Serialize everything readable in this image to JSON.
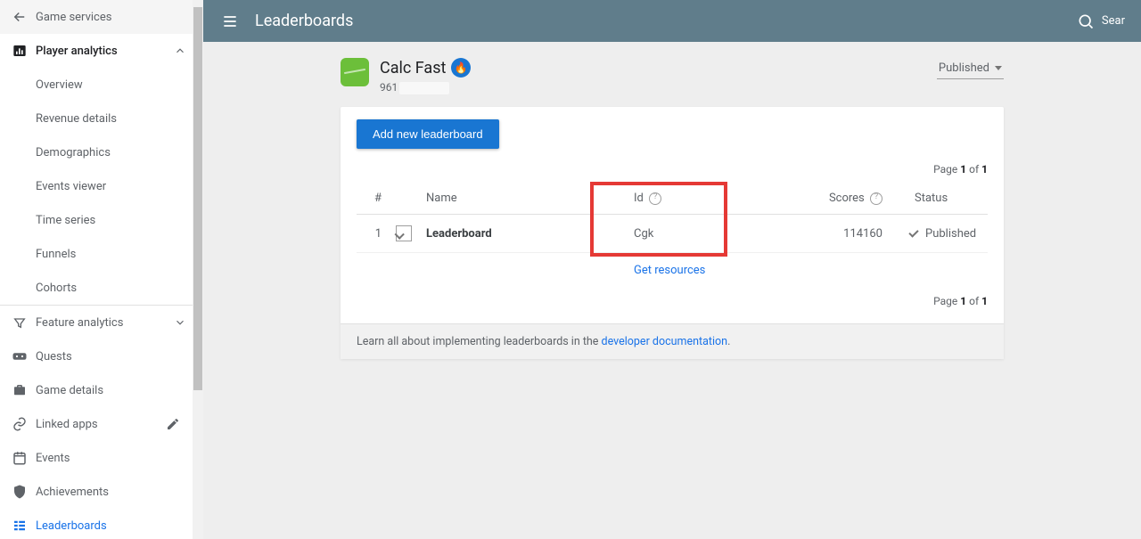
{
  "sidebar": {
    "back_label": "Game services",
    "player_analytics": "Player analytics",
    "pa_items": [
      "Overview",
      "Revenue details",
      "Demographics",
      "Events viewer",
      "Time series",
      "Funnels",
      "Cohorts"
    ],
    "feature_analytics": "Feature analytics",
    "items": [
      "Quests",
      "Game details",
      "Linked apps",
      "Events",
      "Achievements",
      "Leaderboards"
    ]
  },
  "appbar": {
    "title": "Leaderboards",
    "search": "Sear"
  },
  "app": {
    "name": "Calc Fast",
    "id_prefix": "961",
    "publish_state": "Published"
  },
  "card": {
    "add_button": "Add new leaderboard",
    "pager_prefix": "Page",
    "pager_of": "of",
    "page_current": "1",
    "page_total": "1",
    "cols": {
      "num": "#",
      "name": "Name",
      "id": "Id",
      "scores": "Scores",
      "status": "Status"
    },
    "row": {
      "index": "1",
      "name": "Leaderboard",
      "id": "Cgk",
      "scores": "114160",
      "status": "Published"
    },
    "get_resources": "Get resources"
  },
  "info": {
    "prefix": "Learn all about implementing leaderboards in the ",
    "link": "developer documentation",
    "suffix": "."
  }
}
